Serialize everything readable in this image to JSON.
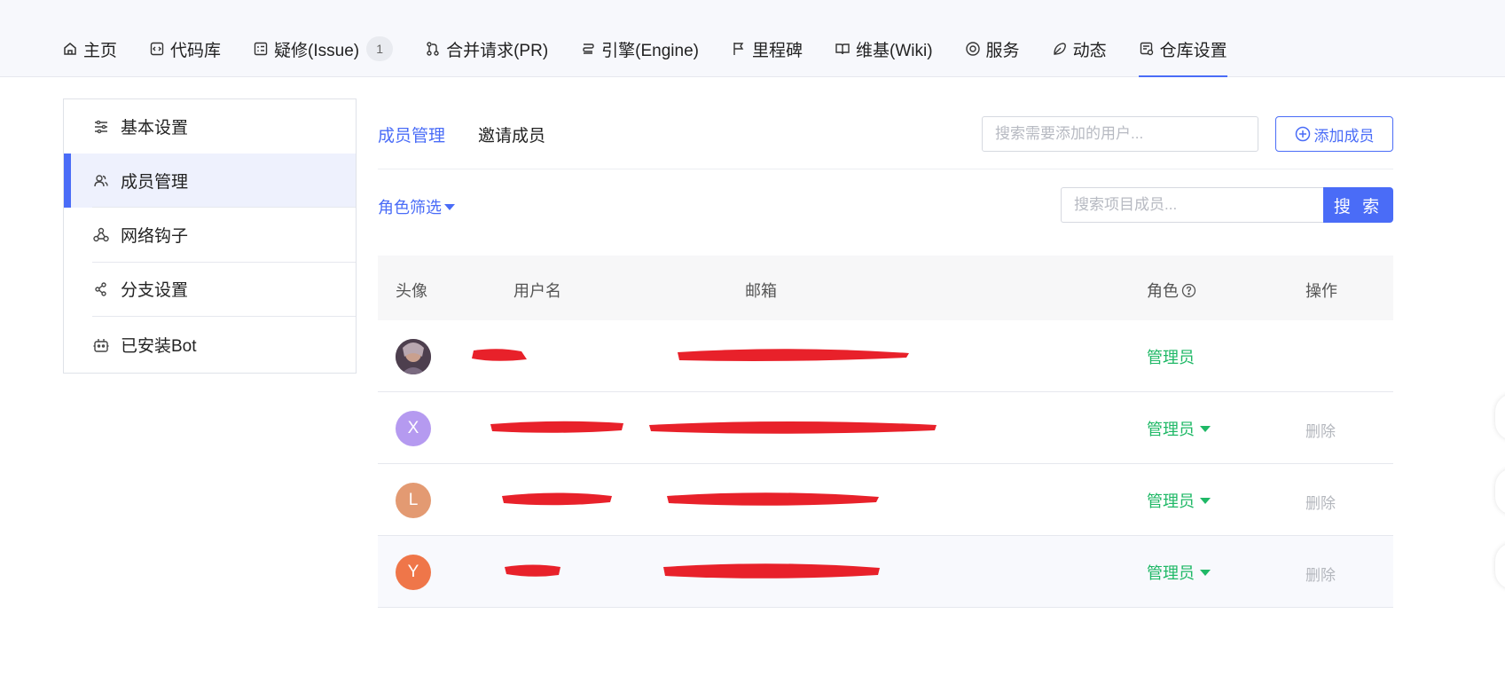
{
  "nav": {
    "tabs": [
      {
        "label": "主页",
        "icon": "home-icon"
      },
      {
        "label": "代码库",
        "icon": "code-icon"
      },
      {
        "label": "疑修(Issue)",
        "icon": "issue-icon",
        "count": "1"
      },
      {
        "label": "合并请求(PR)",
        "icon": "pull-request-icon"
      },
      {
        "label": "引擎(Engine)",
        "icon": "engine-icon"
      },
      {
        "label": "里程碑",
        "icon": "flag-icon"
      },
      {
        "label": "维基(Wiki)",
        "icon": "book-icon"
      },
      {
        "label": "服务",
        "icon": "service-icon"
      },
      {
        "label": "动态",
        "icon": "activity-icon"
      },
      {
        "label": "仓库设置",
        "icon": "repo-settings-icon",
        "active": true
      }
    ]
  },
  "sidebar": {
    "items": [
      {
        "label": "基本设置",
        "icon": "sliders-icon"
      },
      {
        "label": "成员管理",
        "icon": "members-icon",
        "active": true
      },
      {
        "label": "网络钩子",
        "icon": "webhook-icon"
      },
      {
        "label": "分支设置",
        "icon": "branch-icon"
      },
      {
        "label": "已安装Bot",
        "icon": "bot-icon"
      }
    ]
  },
  "main": {
    "subtabs": [
      "成员管理",
      "邀请成员"
    ],
    "user_search_placeholder": "搜索需要添加的用户...",
    "add_member_label": "添加成员",
    "role_filter_label": "角色筛选",
    "member_search_placeholder": "搜索项目成员...",
    "search_button_label": "搜 索"
  },
  "table": {
    "columns": [
      "头像",
      "用户名",
      "邮箱",
      "角色",
      "操作"
    ],
    "rows": [
      {
        "avatar_letter": "",
        "avatar_type": "photo",
        "avatar_color": "#6b5a66",
        "role": "管理员",
        "role_dropdown": false,
        "action": ""
      },
      {
        "avatar_letter": "X",
        "avatar_type": "letter",
        "avatar_color": "#b59af0",
        "role": "管理员",
        "role_dropdown": true,
        "action": "删除"
      },
      {
        "avatar_letter": "L",
        "avatar_type": "letter",
        "avatar_color": "#e39a72",
        "role": "管理员",
        "role_dropdown": true,
        "action": "删除"
      },
      {
        "avatar_letter": "Y",
        "avatar_type": "letter",
        "avatar_color": "#ef7649",
        "role": "管理员",
        "role_dropdown": true,
        "action": "删除"
      }
    ]
  },
  "colors": {
    "accent": "#4a6cf7",
    "role_green": "#1fb866",
    "redaction": "#e8212a"
  }
}
